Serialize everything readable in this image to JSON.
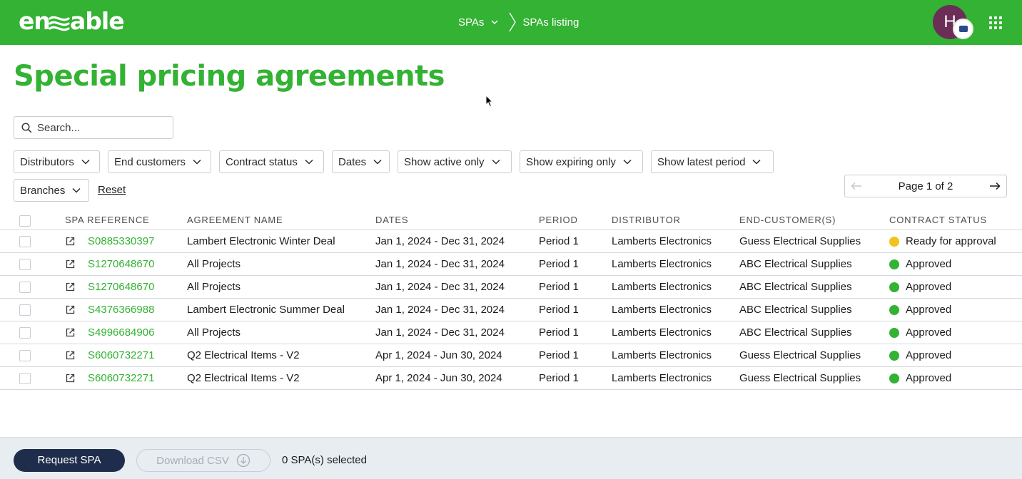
{
  "header": {
    "logo_text": "enable",
    "breadcrumb": [
      {
        "label": "SPAs"
      },
      {
        "label": "SPAs listing"
      }
    ],
    "avatar_initial": "H",
    "colors": {
      "brand": "#33b233",
      "primary_button": "#1f2d4d"
    }
  },
  "page": {
    "title": "Special pricing agreements"
  },
  "search": {
    "placeholder": "Search..."
  },
  "filters": {
    "distributors": "Distributors",
    "end_customers": "End customers",
    "contract_status": "Contract status",
    "dates": "Dates",
    "show_active_only": "Show active only",
    "show_expiring_only": "Show expiring only",
    "show_latest_period": "Show latest period",
    "branches": "Branches",
    "reset": "Reset"
  },
  "pager": {
    "label": "Page 1 of 2"
  },
  "table": {
    "columns": {
      "spa_reference": "SPA REFERENCE",
      "agreement_name": "AGREEMENT NAME",
      "dates": "DATES",
      "period": "PERIOD",
      "distributor": "DISTRIBUTOR",
      "end_customers": "END-CUSTOMER(S)",
      "contract_status": "CONTRACT STATUS"
    },
    "rows": [
      {
        "ref": "S0885330397",
        "name": "Lambert Electronic Winter Deal",
        "dates": "Jan 1, 2024 - Dec 31, 2024",
        "period": "Period 1",
        "distributor": "Lamberts Electronics",
        "customer": "Guess Electrical Supplies",
        "status": "Ready for approval",
        "status_color": "#f4c21d"
      },
      {
        "ref": "S1270648670",
        "name": "All Projects",
        "dates": "Jan 1, 2024 - Dec 31, 2024",
        "period": "Period 1",
        "distributor": "Lamberts Electronics",
        "customer": "ABC Electrical Supplies",
        "status": "Approved",
        "status_color": "#33b233"
      },
      {
        "ref": "S1270648670",
        "name": "All Projects",
        "dates": "Jan 1, 2024 - Dec 31, 2024",
        "period": "Period 1",
        "distributor": "Lamberts Electronics",
        "customer": "ABC Electrical Supplies",
        "status": "Approved",
        "status_color": "#33b233"
      },
      {
        "ref": "S4376366988",
        "name": "Lambert Electronic Summer Deal",
        "dates": "Jan 1, 2024 - Dec 31, 2024",
        "period": "Period 1",
        "distributor": "Lamberts Electronics",
        "customer": "ABC Electrical Supplies",
        "status": "Approved",
        "status_color": "#33b233"
      },
      {
        "ref": "S4996684906",
        "name": "All Projects",
        "dates": "Jan 1, 2024 - Dec 31, 2024",
        "period": "Period 1",
        "distributor": "Lamberts Electronics",
        "customer": "ABC Electrical Supplies",
        "status": "Approved",
        "status_color": "#33b233"
      },
      {
        "ref": "S6060732271",
        "name": "Q2 Electrical Items - V2",
        "dates": "Apr 1, 2024 - Jun 30, 2024",
        "period": "Period 1",
        "distributor": "Lamberts Electronics",
        "customer": "Guess Electrical Supplies",
        "status": "Approved",
        "status_color": "#33b233"
      },
      {
        "ref": "S6060732271",
        "name": "Q2 Electrical Items - V2",
        "dates": "Apr 1, 2024 - Jun 30, 2024",
        "period": "Period 1",
        "distributor": "Lamberts Electronics",
        "customer": "Guess Electrical Supplies",
        "status": "Approved",
        "status_color": "#33b233"
      }
    ]
  },
  "footer": {
    "request_spa": "Request SPA",
    "download_csv": "Download CSV",
    "selected_count": "0 SPA(s) selected"
  }
}
